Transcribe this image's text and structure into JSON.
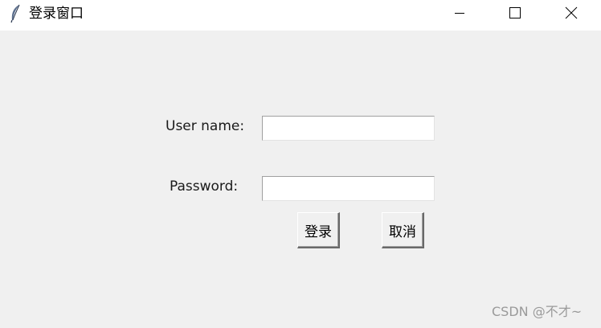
{
  "window": {
    "title": "登录窗口",
    "app_icon": "feather-icon",
    "controls": {
      "minimize": "minimize-icon",
      "maximize": "maximize-icon",
      "close": "close-icon"
    }
  },
  "form": {
    "username_label": "User name:",
    "username_value": "",
    "password_label": "Password:",
    "password_value": ""
  },
  "buttons": {
    "login_label": "登录",
    "cancel_label": "取消"
  },
  "watermark": "CSDN @不才~"
}
